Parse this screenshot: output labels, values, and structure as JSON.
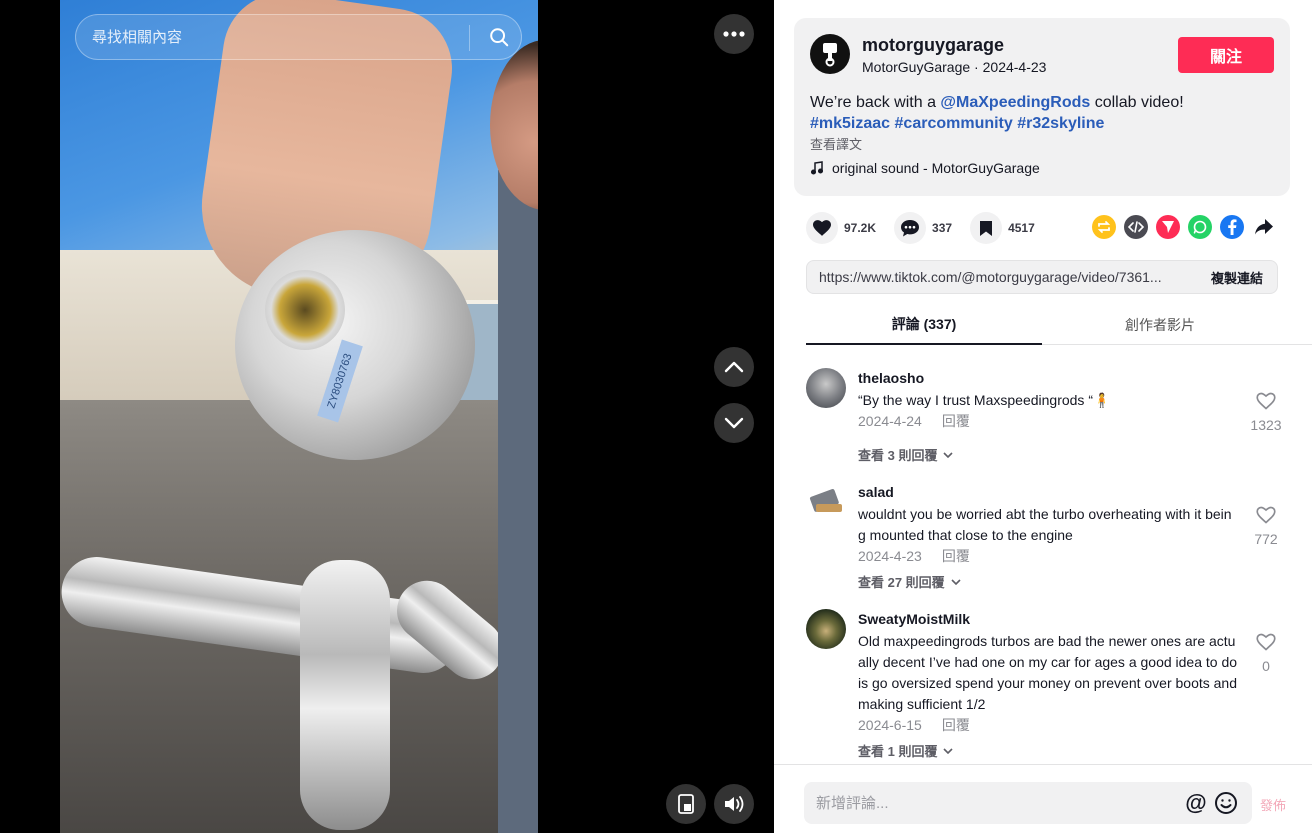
{
  "video": {
    "search_placeholder": "尋找相關內容",
    "turbo_label": "ZY8030763"
  },
  "author": {
    "username": "motorguygarage",
    "display_name": "MotorGuyGarage",
    "separator": " · ",
    "date": "2024-4-23",
    "follow_label": "關注"
  },
  "description": {
    "text_before": "We’re back with a ",
    "mention": "@MaXpeedingRods",
    "text_after": " collab video!",
    "hashtag_1": "#mk5izaac",
    "hashtag_2": "#carcommunity",
    "hashtag_3": "#r32skyline",
    "translate_label": "查看譯文",
    "music": "original sound - MotorGuyGarage"
  },
  "stats": {
    "likes": "97.2K",
    "comments": "337",
    "saves": "4517"
  },
  "share": {
    "url": "https://www.tiktok.com/@motorguygarage/video/7361...",
    "copy_label": "複製連結"
  },
  "tabs": {
    "comments": "評論 (337)",
    "creator_videos": "創作者影片"
  },
  "comments": [
    {
      "user": "thelaosho",
      "text": "“By the way I trust Maxspeedingrods “🧍",
      "date": "2024-4-24",
      "reply_label": "回覆",
      "likes": "1323",
      "more": "查看 3 則回覆"
    },
    {
      "user": "salad",
      "text": "wouldnt you be worried abt the turbo overheating with it being mounted that close to the engine",
      "date": "2024-4-23",
      "reply_label": "回覆",
      "likes": "772",
      "more": "查看 27 則回覆"
    },
    {
      "user": "SweatyMoistMilk",
      "text": "Old maxpeedingrods turbos are bad the newer ones are actually decent I’ve had one on my car for ages a good idea to do is go oversized spend your money on prevent over boots and making sufficient 1/2",
      "date": "2024-6-15",
      "reply_label": "回覆",
      "likes": "0",
      "more": "查看 1 則回覆"
    }
  ],
  "composer": {
    "placeholder": "新增評論...",
    "at_symbol": "@",
    "post_label": "發佈"
  },
  "colors": {
    "accent": "#fe2c55",
    "link": "#2b5db9"
  }
}
